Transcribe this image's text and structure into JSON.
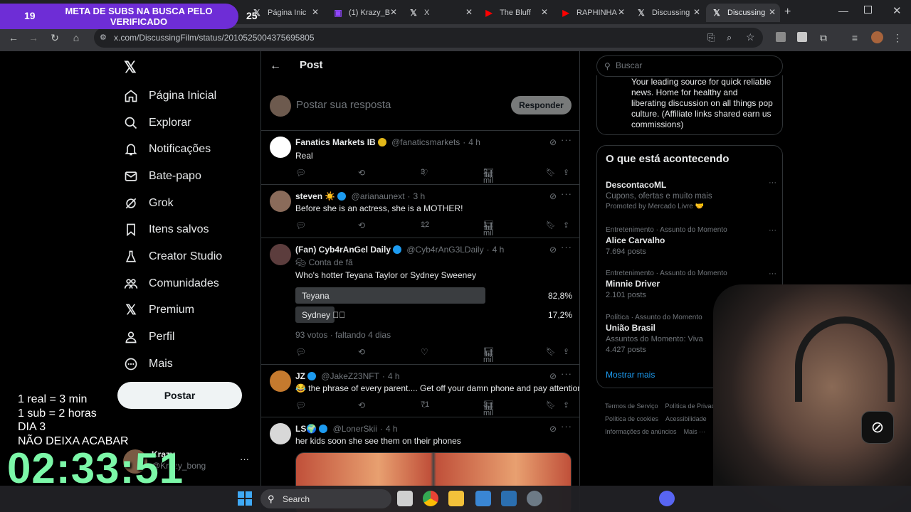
{
  "browser": {
    "tabs": [
      {
        "label": "Página Inic",
        "icon": "x-logo-icon"
      },
      {
        "label": "(1) Krazy_B",
        "icon": "twitch-icon"
      },
      {
        "label": "X",
        "icon": "x-logo-icon"
      },
      {
        "label": "The Bluff",
        "icon": "youtube-icon"
      },
      {
        "label": "RAPHINHA",
        "icon": "youtube-icon"
      },
      {
        "label": "Discussing",
        "icon": "x-logo-icon"
      },
      {
        "label": "Discussing",
        "icon": "x-logo-icon",
        "active": true
      }
    ],
    "url": "x.com/DiscussingFilm/status/2010525004375695805"
  },
  "overlay": {
    "goal_left": "19",
    "goal_text": "META DE SUBS NA BUSCA PELO VERIFICADO",
    "goal_right": "25",
    "note_1": "1 real = 3 min",
    "note_2": "1 sub = 2 horas",
    "note_3": "DIA 3",
    "note_4": "NÃO DEIXA ACABAR",
    "timer": "02:33:51"
  },
  "nav": {
    "items": [
      {
        "label": "Página Inicial",
        "icon": "home-icon"
      },
      {
        "label": "Explorar",
        "icon": "search-icon"
      },
      {
        "label": "Notificações",
        "icon": "bell-icon"
      },
      {
        "label": "Bate-papo",
        "icon": "mail-icon"
      },
      {
        "label": "Grok",
        "icon": "grok-icon"
      },
      {
        "label": "Itens salvos",
        "icon": "bookmark-icon"
      },
      {
        "label": "Creator Studio",
        "icon": "flask-icon"
      },
      {
        "label": "Comunidades",
        "icon": "people-icon"
      },
      {
        "label": "Premium",
        "icon": "x-logo-icon"
      },
      {
        "label": "Perfil",
        "icon": "person-icon"
      },
      {
        "label": "Mais",
        "icon": "more-circle-icon"
      }
    ],
    "post_button": "Postar",
    "profile_name": "Krazy",
    "profile_handle": "@Krazy_bong"
  },
  "center": {
    "header_title": "Post",
    "reply_placeholder": "Postar sua resposta",
    "reply_button": "Responder",
    "tweets": [
      {
        "name": "Fanatics Markets IB",
        "handle": "@fanaticsmarkets",
        "time": "4 h",
        "text": "Real",
        "replies": "",
        "reposts": "",
        "likes": "3",
        "views": "2 mil"
      },
      {
        "name": "steven ☀️",
        "handle": "@arianaunext",
        "time": "3 h",
        "text": "Before she is an actress, she is a MOTHER!",
        "replies": "",
        "reposts": "",
        "likes": "12",
        "views": "1 mil"
      },
      {
        "name": "(Fan) Cyb4rAnGel Daily",
        "handle": "@Cyb4rAnG3LDaily",
        "time": "4 h",
        "badge": "Conta de fã",
        "text": "Who's hotter Teyana Taylor or Sydney Sweeney",
        "likes": "",
        "views": "1 mil"
      },
      {
        "name": "JZ",
        "handle": "@JakeZ23NFT",
        "time": "4 h",
        "text": "😂 the phrase of every parent.... Get off your damn phone and pay attention",
        "likes": "71",
        "views": "3 mil"
      },
      {
        "name": "LS🌍",
        "handle": "@LonerSkii",
        "time": "4 h",
        "text": "her kids soon she see them on their phones"
      }
    ],
    "poll": {
      "options": [
        {
          "label": "Teyana",
          "pct": "82,8%",
          "value": 82.8
        },
        {
          "label": "Sydney",
          "pct": "17,2%",
          "value": 17.2
        }
      ],
      "footer": "93 votos · faltando 4 dias"
    }
  },
  "right": {
    "search_placeholder": "Buscar",
    "bio": "Your leading source for quick reliable news. Home for healthy and liberating discussion on all things pop culture. (Affiliate links shared earn us commissions)",
    "trends_title": "O que está acontecendo",
    "trends": [
      {
        "context": "",
        "name": "DescontacoML",
        "sub": "Cupons, ofertas e muito mais",
        "sub2": "Promoted by Mercado Livre 🤝"
      },
      {
        "context": "Entretenimento · Assunto do Momento",
        "name": "Alice Carvalho",
        "sub": "7.694 posts"
      },
      {
        "context": "Entretenimento · Assunto do Momento",
        "name": "Minnie Driver",
        "sub": "2.101 posts"
      },
      {
        "context": "Política · Assunto do Momento",
        "name": "União Brasil",
        "sub": "Assuntos do Momento: Viva",
        "sub2": "4.427 posts"
      }
    ],
    "show_more": "Mostrar mais",
    "footer": [
      "Termos de Serviço",
      "Política de Privacidade",
      "Política de cookies",
      "Acessibilidade",
      "Informações de anúncios",
      "Mais ···"
    ]
  },
  "taskbar": {
    "search_label": "Search"
  },
  "colors": {
    "accent": "#1d9bf0",
    "goal_bg": "#6e2dd6",
    "timer": "#7cf7a8"
  }
}
